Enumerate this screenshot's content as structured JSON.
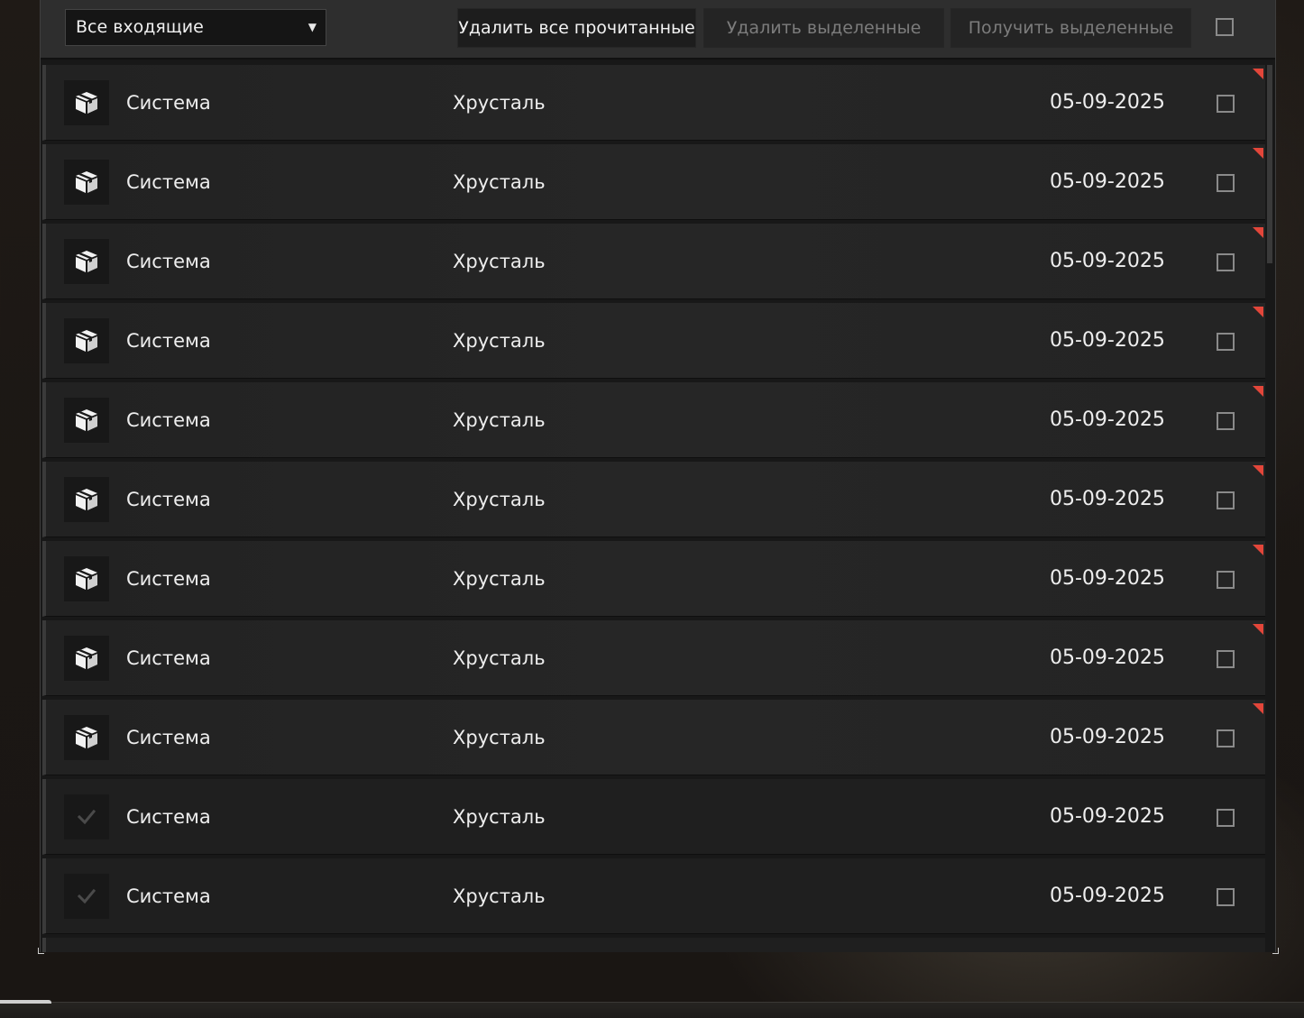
{
  "toolbar": {
    "filter_value": "Все входящие",
    "delete_read_label": "Удалить все прочитанные",
    "delete_selected_label": "Удалить выделенные",
    "get_selected_label": "Получить выделенные"
  },
  "messages": [
    {
      "sender": "Система",
      "subject": "Хрусталь",
      "date": "05-09-2025",
      "unread": true,
      "icon": "package-icon"
    },
    {
      "sender": "Система",
      "subject": "Хрусталь",
      "date": "05-09-2025",
      "unread": true,
      "icon": "package-icon"
    },
    {
      "sender": "Система",
      "subject": "Хрусталь",
      "date": "05-09-2025",
      "unread": true,
      "icon": "package-icon"
    },
    {
      "sender": "Система",
      "subject": "Хрусталь",
      "date": "05-09-2025",
      "unread": true,
      "icon": "package-icon"
    },
    {
      "sender": "Система",
      "subject": "Хрусталь",
      "date": "05-09-2025",
      "unread": true,
      "icon": "package-icon"
    },
    {
      "sender": "Система",
      "subject": "Хрусталь",
      "date": "05-09-2025",
      "unread": true,
      "icon": "package-icon"
    },
    {
      "sender": "Система",
      "subject": "Хрусталь",
      "date": "05-09-2025",
      "unread": true,
      "icon": "package-icon"
    },
    {
      "sender": "Система",
      "subject": "Хрусталь",
      "date": "05-09-2025",
      "unread": true,
      "icon": "package-icon"
    },
    {
      "sender": "Система",
      "subject": "Хрусталь",
      "date": "05-09-2025",
      "unread": true,
      "icon": "package-icon"
    },
    {
      "sender": "Система",
      "subject": "Хрусталь",
      "date": "05-09-2025",
      "unread": false,
      "icon": "checkmark-icon"
    },
    {
      "sender": "Система",
      "subject": "Хрусталь",
      "date": "05-09-2025",
      "unread": false,
      "icon": "checkmark-icon"
    },
    {
      "sender": "",
      "subject": "",
      "date": "",
      "unread": false,
      "icon": ""
    }
  ],
  "colors": {
    "unread_flag": "#e2463a",
    "panel_bg": "#181818",
    "row_bg": "#242424"
  }
}
